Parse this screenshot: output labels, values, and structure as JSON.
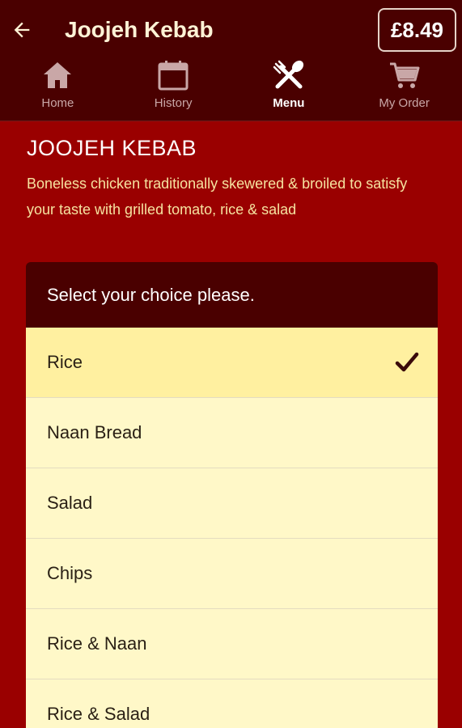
{
  "header": {
    "title": "Joojeh Kebab",
    "price": "£8.49"
  },
  "tabs": [
    {
      "label": "Home",
      "icon": "home-icon",
      "active": false
    },
    {
      "label": "History",
      "icon": "calendar-icon",
      "active": false
    },
    {
      "label": "Menu",
      "icon": "fork-knife-icon",
      "active": true
    },
    {
      "label": "My Order",
      "icon": "cart-icon",
      "active": false
    }
  ],
  "dish": {
    "title": "JOOJEH KEBAB",
    "description": "Boneless chicken traditionally skewered & broiled to satisfy your taste with grilled tomato, rice & salad"
  },
  "choices": {
    "prompt": "Select your choice please.",
    "options": [
      {
        "label": "Rice",
        "selected": true
      },
      {
        "label": "Naan Bread",
        "selected": false
      },
      {
        "label": "Salad",
        "selected": false
      },
      {
        "label": "Chips",
        "selected": false
      },
      {
        "label": "Rice & Naan",
        "selected": false
      },
      {
        "label": "Rice & Salad",
        "selected": false
      }
    ]
  },
  "colors": {
    "appbar": "#4a0000",
    "background": "#9a0000",
    "option_bg": "#fff8c8",
    "selected_bg": "#fff0a0",
    "accent_text": "#f6e3a0"
  }
}
